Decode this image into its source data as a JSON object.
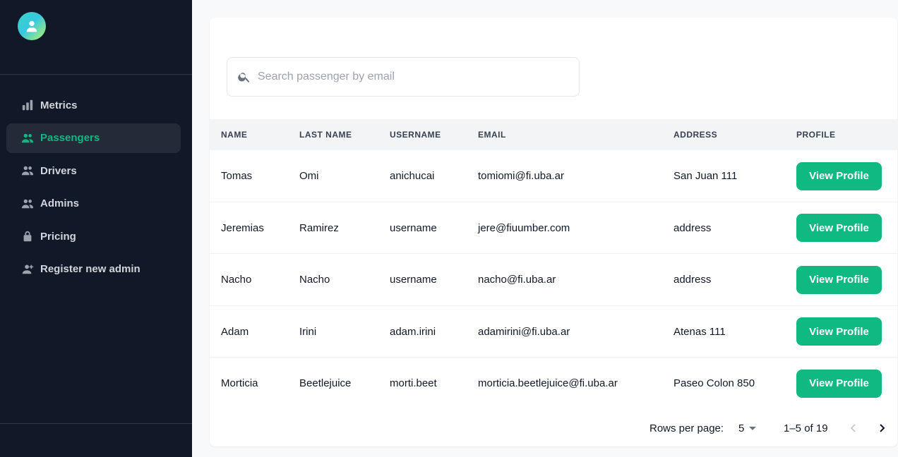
{
  "sidebar": {
    "logo_icon": "user-avatar-icon",
    "items": [
      {
        "label": "Metrics",
        "icon": "bar-chart-icon",
        "active": false
      },
      {
        "label": "Passengers",
        "icon": "people-icon",
        "active": true
      },
      {
        "label": "Drivers",
        "icon": "people-icon",
        "active": false
      },
      {
        "label": "Admins",
        "icon": "people-icon",
        "active": false
      },
      {
        "label": "Pricing",
        "icon": "lock-icon",
        "active": false
      },
      {
        "label": "Register new admin",
        "icon": "person-add-icon",
        "active": false
      }
    ]
  },
  "search": {
    "placeholder": "Search passenger by email",
    "value": ""
  },
  "table": {
    "headers": [
      "NAME",
      "LAST NAME",
      "USERNAME",
      "EMAIL",
      "ADDRESS",
      "PROFILE"
    ],
    "rows": [
      {
        "name": "Tomas",
        "last_name": "Omi",
        "username": "anichucai",
        "email": "tomiomi@fi.uba.ar",
        "address": "San Juan 111",
        "action": "View Profile"
      },
      {
        "name": "Jeremias",
        "last_name": "Ramirez",
        "username": "username",
        "email": "jere@fiuumber.com",
        "address": "address",
        "action": "View Profile"
      },
      {
        "name": "Nacho",
        "last_name": "Nacho",
        "username": "username",
        "email": "nacho@fi.uba.ar",
        "address": "address",
        "action": "View Profile"
      },
      {
        "name": "Adam",
        "last_name": "Irini",
        "username": "adam.irini",
        "email": "adamirini@fi.uba.ar",
        "address": "Atenas 111",
        "action": "View Profile"
      },
      {
        "name": "Morticia",
        "last_name": "Beetlejuice",
        "username": "morti.beet",
        "email": "morticia.beetlejuice@fi.uba.ar",
        "address": "Paseo Colon 850",
        "action": "View Profile"
      }
    ]
  },
  "pagination": {
    "rows_per_page_label": "Rows per page:",
    "rows_per_page": "5",
    "range": "1–5 of 19"
  },
  "colors": {
    "sidebar_bg": "#111827",
    "accent": "#10b981",
    "page_bg": "#f8f9fa"
  }
}
